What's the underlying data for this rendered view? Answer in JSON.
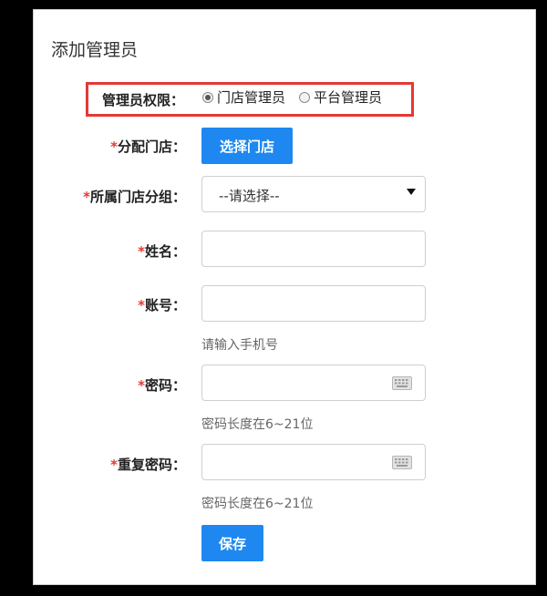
{
  "page": {
    "title": "添加管理员"
  },
  "permission": {
    "label": "管理员权限：",
    "options": [
      {
        "label": "门店管理员",
        "checked": true
      },
      {
        "label": "平台管理员",
        "checked": false
      }
    ]
  },
  "form": {
    "store": {
      "required_mark": "*",
      "label": "分配门店：",
      "button_label": "选择门店"
    },
    "group": {
      "required_mark": "*",
      "label": "所属门店分组：",
      "selected": "--请选择--"
    },
    "name": {
      "required_mark": "*",
      "label": "姓名：",
      "value": ""
    },
    "account": {
      "required_mark": "*",
      "label": "账号：",
      "value": "",
      "hint": "请输入手机号"
    },
    "password": {
      "required_mark": "*",
      "label": "密码：",
      "value": "",
      "hint": "密码长度在6~21位",
      "icon": "keyboard-icon"
    },
    "repeat_password": {
      "required_mark": "*",
      "label": "重复密码：",
      "value": "",
      "hint": "密码长度在6~21位",
      "icon": "keyboard-icon"
    }
  },
  "actions": {
    "save_label": "保存"
  },
  "colors": {
    "primary": "#1e88f0",
    "required": "#e53935",
    "highlight": "#e53935"
  }
}
